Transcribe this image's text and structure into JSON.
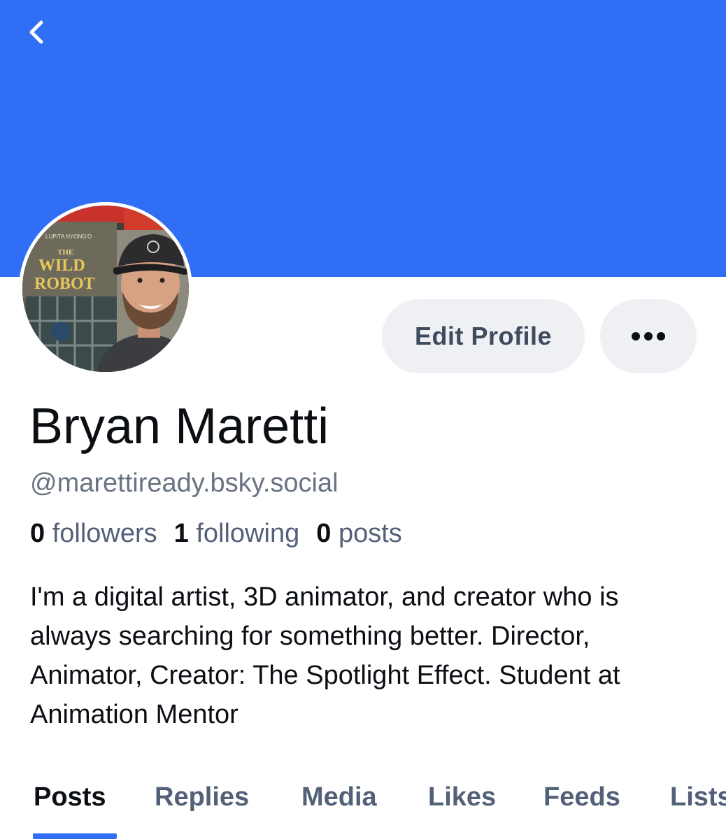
{
  "header": {
    "banner_color": "#306ef6",
    "back_icon": "chevron-left-icon"
  },
  "profile": {
    "avatar_poster": {
      "line1": "LUPITA NYONG'O",
      "line2": "THE",
      "line3": "WILD",
      "line4": "ROBOT"
    },
    "display_name": "Bryan Maretti",
    "handle": "@marettiready.bsky.social",
    "stats": {
      "followers_count": "0",
      "followers_label": "followers",
      "following_count": "1",
      "following_label": "following",
      "posts_count": "0",
      "posts_label": "posts"
    },
    "bio": "I'm a digital artist, 3D animator, and creator who is always searching for something better. Director, Animator, Creator: The Spotlight Effect. Student at Animation Mentor"
  },
  "actions": {
    "edit_profile_label": "Edit Profile",
    "more_icon": "more-horizontal-icon"
  },
  "tabs": [
    {
      "label": "Posts",
      "active": true
    },
    {
      "label": "Replies",
      "active": false
    },
    {
      "label": "Media",
      "active": false
    },
    {
      "label": "Likes",
      "active": false
    },
    {
      "label": "Feeds",
      "active": false
    },
    {
      "label": "Lists",
      "active": false
    }
  ],
  "colors": {
    "accent": "#306ef6",
    "text_primary": "#0b0f14",
    "text_secondary": "#536178",
    "button_bg": "#eef0f3"
  }
}
